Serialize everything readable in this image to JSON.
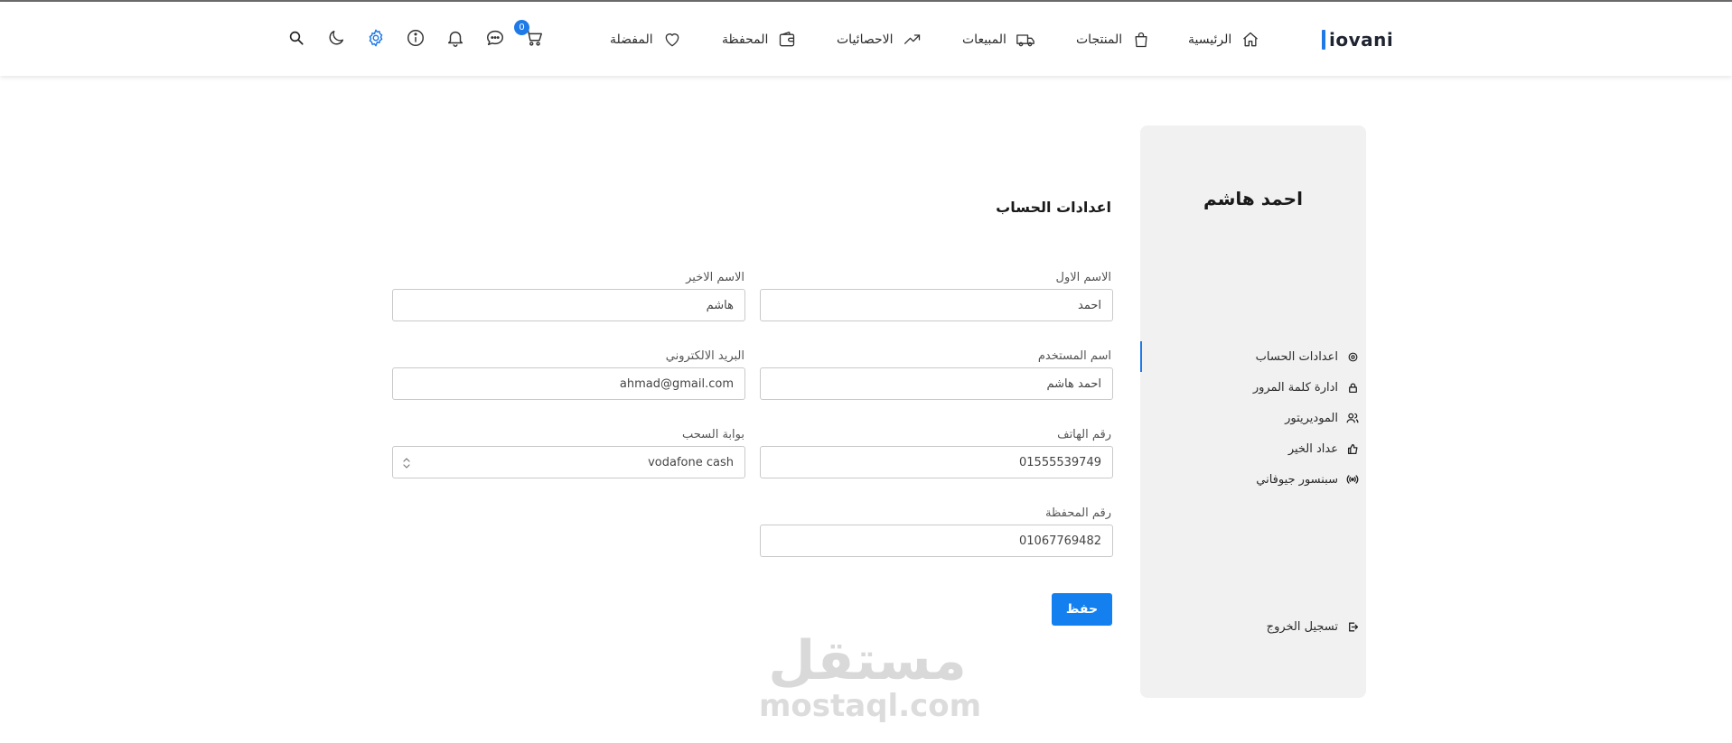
{
  "app": {
    "logo_text": "iovani"
  },
  "nav": {
    "items": [
      {
        "label": "الرئيسية",
        "icon": "home-icon"
      },
      {
        "label": "المنتجات",
        "icon": "shopping-bag-icon"
      },
      {
        "label": "المبيعات",
        "icon": "truck-icon"
      },
      {
        "label": "الاحصائيات",
        "icon": "trending-up-icon"
      },
      {
        "label": "المحفظة",
        "icon": "wallet-icon"
      },
      {
        "label": "المفضلة",
        "icon": "heart-icon"
      }
    ]
  },
  "toolbar": {
    "cart_count": "0",
    "icons": [
      "cart-icon",
      "chat-icon",
      "bell-icon",
      "info-icon",
      "gear-icon",
      "moon-icon",
      "search-icon"
    ],
    "active_icon_color": "#1f7ae8"
  },
  "sidebar": {
    "profile_name": "احمد هاشم",
    "items": [
      {
        "label": "اعدادات الحساب",
        "icon": "gear-icon",
        "active": true
      },
      {
        "label": "ادارة كلمة المرور",
        "icon": "lock-icon"
      },
      {
        "label": "الموديريتور",
        "icon": "users-icon"
      },
      {
        "label": "عداد الخير",
        "icon": "thumbs-up-icon"
      },
      {
        "label": "سبنسور جيوفاني",
        "icon": "broadcast-icon"
      }
    ],
    "logout_label": "تسجيل الخروج"
  },
  "form": {
    "title": "اعدادات الحساب",
    "first_name": {
      "label": "الاسم الاول",
      "value": "احمد"
    },
    "last_name": {
      "label": "الاسم الاخير",
      "value": "هاشم"
    },
    "username": {
      "label": "اسم المستخدم",
      "value": "احمد هاشم"
    },
    "email": {
      "label": "البريد الالكتروني",
      "value": "ahmad@gmail.com"
    },
    "phone": {
      "label": "رقم الهاتف",
      "value": "01555539749"
    },
    "withdraw_gateway": {
      "label": "بوابة السحب",
      "value": "vodafone cash"
    },
    "wallet_number": {
      "label": "رقم المحفظة",
      "value": "01067769482"
    },
    "save_label": "حفظ"
  },
  "watermark": {
    "arabic": "مستقل",
    "latin": "mostaql.com"
  },
  "colors": {
    "accent": "#1f7ae8",
    "button": "#1480f0",
    "sidebar_bg": "#f1f1f1"
  }
}
